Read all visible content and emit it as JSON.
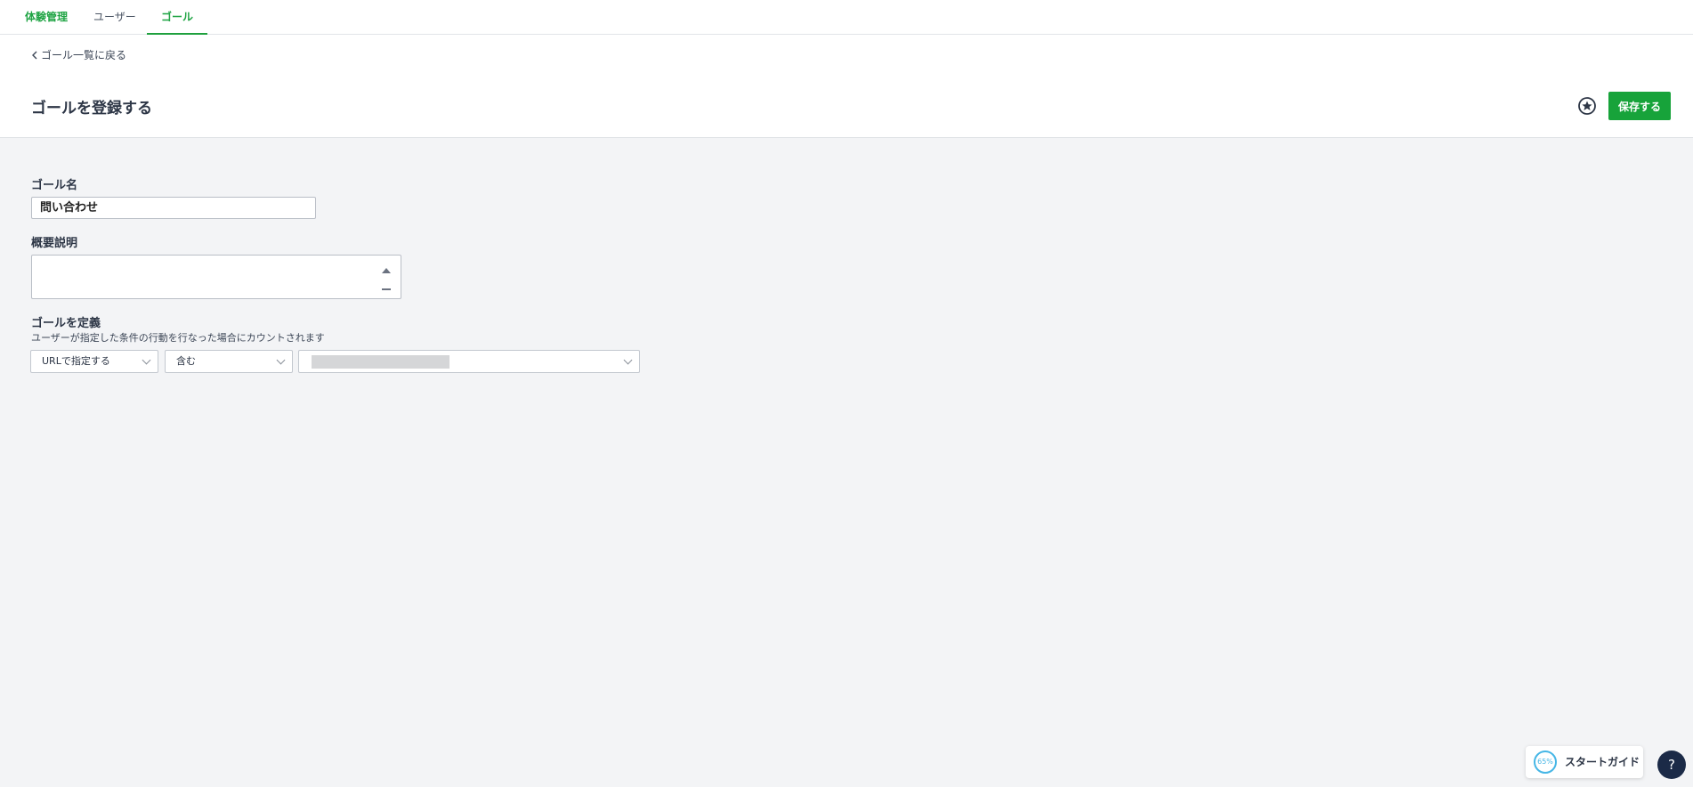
{
  "nav": {
    "tabs": [
      {
        "label": "体験管理"
      },
      {
        "label": "ユーザー"
      },
      {
        "label": "ゴール"
      }
    ]
  },
  "header": {
    "back_label": "ゴール一覧に戻る",
    "title": "ゴールを登録する",
    "save_label": "保存する"
  },
  "form": {
    "name_label": "ゴール名",
    "name_value": "問い合わせ",
    "description_label": "概要説明",
    "description_value": "",
    "definition_label": "ゴールを定義",
    "definition_note": "ユーザーが指定した条件の行動を行なった場合にカウントされます",
    "match_type": "URLで指定する",
    "operator": "含む",
    "url_value": ""
  },
  "guide": {
    "progress": "65%",
    "label": "スタートガイド"
  },
  "help": {
    "label": "?"
  },
  "colors": {
    "accent": "#17a33a",
    "guide_ring": "#45b6e6",
    "help_bg": "#1b2a47"
  }
}
